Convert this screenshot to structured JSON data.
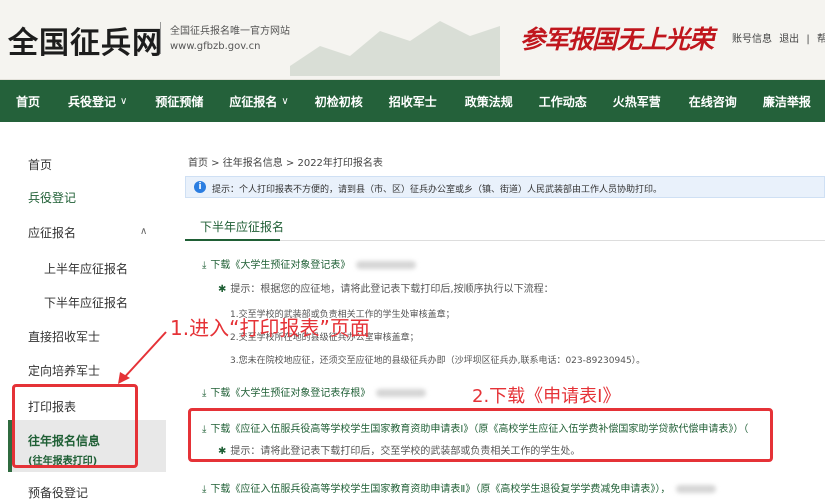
{
  "header": {
    "logo": "全国征兵网",
    "site_desc_line1": "全国征兵报名唯一官方网站",
    "site_desc_line2": "www.gfbzb.gov.cn",
    "slogan1": "参军报国",
    "slogan2": "无上光荣",
    "account_link": "账号信息",
    "logout_link": "退出",
    "sep": "|",
    "help_link": "帮"
  },
  "nav": {
    "items": [
      {
        "label": "首页"
      },
      {
        "label": "兵役登记"
      },
      {
        "label": "预征预储"
      },
      {
        "label": "应征报名"
      },
      {
        "label": "初检初核"
      },
      {
        "label": "招收军士"
      },
      {
        "label": "政策法规"
      },
      {
        "label": "工作动态"
      },
      {
        "label": "火热军营"
      },
      {
        "label": "在线咨询"
      },
      {
        "label": "廉洁举报"
      }
    ],
    "caret": "∨"
  },
  "sidebar": {
    "home": "首页",
    "registration": "兵役登记",
    "apply": "应征报名",
    "caret_up": "∧",
    "first_half": "上半年应征报名",
    "second_half": "下半年应征报名",
    "direct_nco": "直接招收军士",
    "targeted_nco": "定向培养军士",
    "print_form": "打印报表",
    "past_info": "往年报名信息",
    "past_info_sub": "(往年报表打印)",
    "reserve": "预备役登记"
  },
  "content": {
    "breadcrumb": "首页 > 往年报名信息 > 2022年打印报名表",
    "tip_icon": "i",
    "tip_text": "提示：个人打印报表不方便的，请到县（市、区）征兵办公室或乡（镇、街道）人民武装部由工作人员协助打印。",
    "tab_label": "下半年应征报名",
    "download1": "下载《大学生预征对象登记表》",
    "hint1": "提示：根据您的应征地，请将此登记表下载打印后,按顺序执行以下流程：",
    "step1": "1.交至学校的武装部或负责相关工作的学生处审核盖章；",
    "step2": "2.交至学校所在地的县级征兵办公室审核盖章；",
    "step3": "3.您未在院校地应征，还须交至应征地的县级征兵办即（沙坪坝区征兵办,联系电话：023-89230945）。",
    "download2": "下载《大学生预征对象登记表存根》",
    "download3": "下载《应征入伍服兵役高等学校学生国家教育资助申请表Ⅰ》（原《高校学生应征入伍学费补偿国家助学贷款代偿申请表》）（",
    "hint2": "提示：请将此登记表下载打印后，交至学校的武装部或负责相关工作的学生处。",
    "download4": "下载《应征入伍服兵役高等学校学生国家教育资助申请表Ⅱ》（原《高校学生退役复学学费减免申请表》），",
    "dl_icon": "⤓",
    "hint_star": "✱"
  },
  "annotations": {
    "step1": "1.进入“打印报表”页面",
    "step2": "2.下载《申请表Ⅰ》"
  },
  "colors": {
    "nav_bg": "#24613a",
    "accent": "#1f5f35",
    "annotation": "#e53237",
    "slogan": "#c0161d"
  }
}
